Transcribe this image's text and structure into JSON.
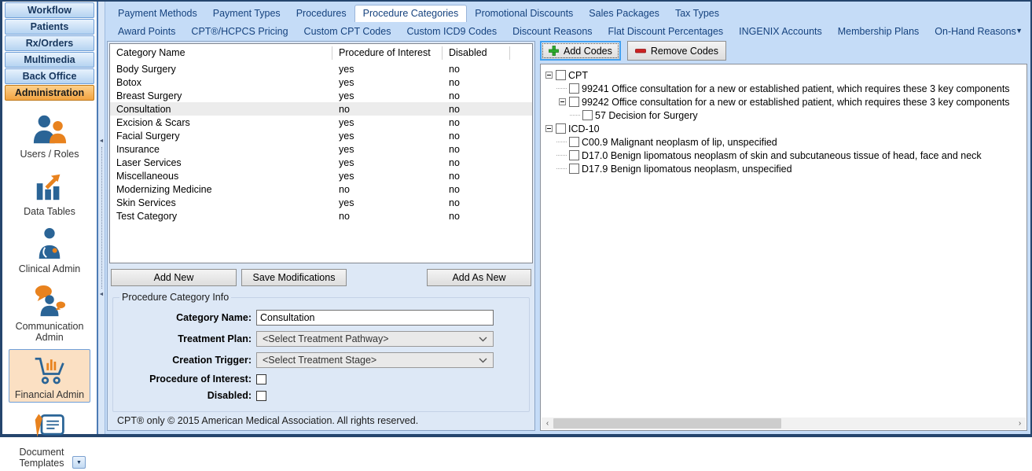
{
  "sidebar": {
    "nav_buttons": [
      {
        "label": "Workflow",
        "active": false
      },
      {
        "label": "Patients",
        "active": false
      },
      {
        "label": "Rx/Orders",
        "active": false
      },
      {
        "label": "Multimedia",
        "active": false
      },
      {
        "label": "Back Office",
        "active": false
      },
      {
        "label": "Administration",
        "active": true
      }
    ],
    "admin_items": [
      {
        "label": "Users / Roles",
        "icon": "users-icon",
        "selected": false
      },
      {
        "label": "Data Tables",
        "icon": "bar-chart-icon",
        "selected": false
      },
      {
        "label": "Clinical Admin",
        "icon": "clinician-icon",
        "selected": false
      },
      {
        "label": "Communication Admin",
        "icon": "speech-bubbles-icon",
        "selected": false
      },
      {
        "label": "Financial Admin",
        "icon": "shopping-cart-icon",
        "selected": true
      },
      {
        "label": "Document Templates",
        "icon": "document-pen-icon",
        "selected": false,
        "has_dropdown": true
      }
    ]
  },
  "tabs": {
    "row1": [
      {
        "label": "Payment Methods",
        "active": false
      },
      {
        "label": "Payment Types",
        "active": false
      },
      {
        "label": "Procedures",
        "active": false
      },
      {
        "label": "Procedure Categories",
        "active": true
      },
      {
        "label": "Promotional Discounts",
        "active": false
      },
      {
        "label": "Sales Packages",
        "active": false
      },
      {
        "label": "Tax Types",
        "active": false
      }
    ],
    "row2": [
      {
        "label": "Award Points",
        "active": false
      },
      {
        "label": "CPT®/HCPCS Pricing",
        "active": false
      },
      {
        "label": "Custom CPT Codes",
        "active": false
      },
      {
        "label": "Custom ICD9 Codes",
        "active": false
      },
      {
        "label": "Discount Reasons",
        "active": false
      },
      {
        "label": "Flat Discount Percentages",
        "active": false
      },
      {
        "label": "INGENIX Accounts",
        "active": false
      },
      {
        "label": "Membership Plans",
        "active": false
      },
      {
        "label": "On-Hand Reasons",
        "active": false
      }
    ]
  },
  "table": {
    "columns": [
      "Category Name",
      "Procedure of Interest",
      "Disabled"
    ],
    "rows": [
      {
        "name": "Body Surgery",
        "procedure_of_interest": "yes",
        "disabled": "no",
        "selected": false
      },
      {
        "name": "Botox",
        "procedure_of_interest": "yes",
        "disabled": "no",
        "selected": false
      },
      {
        "name": "Breast Surgery",
        "procedure_of_interest": "yes",
        "disabled": "no",
        "selected": false
      },
      {
        "name": "Consultation",
        "procedure_of_interest": "no",
        "disabled": "no",
        "selected": true
      },
      {
        "name": "Excision & Scars",
        "procedure_of_interest": "yes",
        "disabled": "no",
        "selected": false
      },
      {
        "name": "Facial Surgery",
        "procedure_of_interest": "yes",
        "disabled": "no",
        "selected": false
      },
      {
        "name": "Insurance",
        "procedure_of_interest": "yes",
        "disabled": "no",
        "selected": false
      },
      {
        "name": "Laser Services",
        "procedure_of_interest": "yes",
        "disabled": "no",
        "selected": false
      },
      {
        "name": "Miscellaneous",
        "procedure_of_interest": "yes",
        "disabled": "no",
        "selected": false
      },
      {
        "name": "Modernizing Medicine",
        "procedure_of_interest": "no",
        "disabled": "no",
        "selected": false
      },
      {
        "name": "Skin Services",
        "procedure_of_interest": "yes",
        "disabled": "no",
        "selected": false
      },
      {
        "name": "Test Category",
        "procedure_of_interest": "no",
        "disabled": "no",
        "selected": false
      }
    ]
  },
  "actions": {
    "add_new": "Add New",
    "save_modifications": "Save Modifications",
    "add_as_new": "Add As New"
  },
  "form": {
    "legend": "Procedure Category Info",
    "fields": {
      "category_name": {
        "label": "Category Name:",
        "value": "Consultation"
      },
      "treatment_plan": {
        "label": "Treatment Plan:",
        "value": "<Select Treatment Pathway>"
      },
      "creation_trigger": {
        "label": "Creation Trigger:",
        "value": "<Select Treatment Stage>"
      },
      "procedure_of_interest": {
        "label": "Procedure of Interest:",
        "checked": false
      },
      "disabled": {
        "label": "Disabled:",
        "checked": false
      }
    }
  },
  "footer": {
    "text": "CPT® only © 2015 American Medical Association. All rights reserved."
  },
  "codes_panel": {
    "add_button": "Add Codes",
    "remove_button": "Remove Codes",
    "tree": [
      {
        "label": "CPT",
        "expanded": true,
        "checked": false,
        "children": [
          {
            "label": "99241 Office consultation for a new or established patient, which requires these 3 key components",
            "checked": false
          },
          {
            "label": "99242 Office consultation for a new or established patient, which requires these 3 key components",
            "expanded": true,
            "checked": false,
            "children": [
              {
                "label": "57 Decision for Surgery",
                "checked": false
              }
            ]
          }
        ]
      },
      {
        "label": "ICD-10",
        "expanded": true,
        "checked": false,
        "children": [
          {
            "label": "C00.9 Malignant neoplasm of lip, unspecified",
            "checked": false
          },
          {
            "label": "D17.0 Benign lipomatous neoplasm of skin and subcutaneous tissue of head, face and neck",
            "checked": false
          },
          {
            "label": "D17.9 Benign lipomatous neoplasm, unspecified",
            "checked": false
          }
        ]
      }
    ]
  },
  "colors": {
    "window_border": "#25456d",
    "active_nav_orange": "#f2a341",
    "nav_blue_light": "#e7f2fd",
    "nav_blue_dark": "#b5d3f1",
    "icon_blue": "#2a6496",
    "icon_orange": "#e8821e",
    "tab_text": "#15427e",
    "selected_row": "#ececec",
    "add_icon_green": "#2fae2f",
    "remove_icon_red": "#cc2222",
    "focus_border_blue": "#41a0f0"
  }
}
